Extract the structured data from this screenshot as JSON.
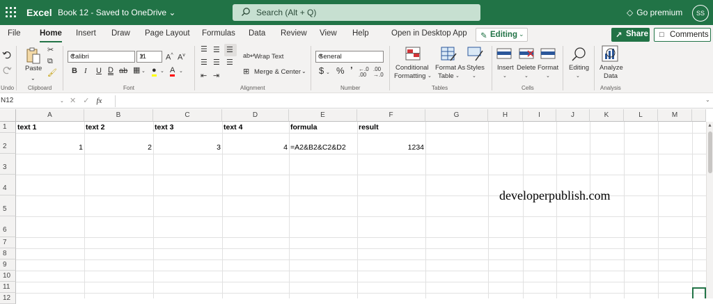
{
  "titlebar": {
    "app_name": "Excel",
    "doc_name": "Book 12 - Saved to OneDrive ⌄",
    "search_placeholder": "Search (Alt + Q)",
    "premium_label": "Go premium",
    "avatar_initials": "SS"
  },
  "ribbon_tabs": [
    "File",
    "Home",
    "Insert",
    "Draw",
    "Page Layout",
    "Formulas",
    "Data",
    "Review",
    "View",
    "Help",
    "Open in Desktop App"
  ],
  "active_tab": "Home",
  "editing_label": "Editing",
  "share_label": "Share",
  "comments_label": "Comments",
  "ribbon": {
    "undo_label": "Undo",
    "paste_label": "Paste",
    "clipboard_label": "Clipboard",
    "font_name": "Calibri",
    "font_size": "11",
    "font_label": "Font",
    "wrap_text": "Wrap Text",
    "merge_center": "Merge & Center",
    "alignment_label": "Alignment",
    "number_format": "General",
    "number_label": "Number",
    "conditional_formatting_1": "Conditional",
    "conditional_formatting_2": "Formatting",
    "format_as_table_1": "Format As",
    "format_as_table_2": "Table",
    "styles": "Styles",
    "tables_label": "Tables",
    "insert": "Insert",
    "delete": "Delete",
    "format": "Format",
    "cells_label": "Cells",
    "editing": "Editing",
    "analyze_data_1": "Analyze",
    "analyze_data_2": "Data",
    "analysis_label": "Analysis"
  },
  "formula_bar": {
    "name_box": "N12",
    "formula": ""
  },
  "columns": [
    "A",
    "B",
    "C",
    "D",
    "E",
    "F",
    "G",
    "H",
    "I",
    "J",
    "K",
    "L",
    "M"
  ],
  "rows": [
    "1",
    "2",
    "3",
    "4",
    "5",
    "6",
    "7",
    "8",
    "9",
    "10",
    "11",
    "12"
  ],
  "cells": {
    "A1": "text 1",
    "B1": "text 2",
    "C1": "text 3",
    "D1": "text  4",
    "E1": "formula",
    "F1": "result",
    "A2": "1",
    "B2": "2",
    "C2": "3",
    "D2": "4",
    "E2": "=A2&B2&C2&D2",
    "F2": "1234"
  },
  "watermark": "developerpublish.com",
  "colors": {
    "brand": "#217346",
    "search_bg": "#c7e0d1",
    "ribbon_bg": "#f3f2f1"
  }
}
